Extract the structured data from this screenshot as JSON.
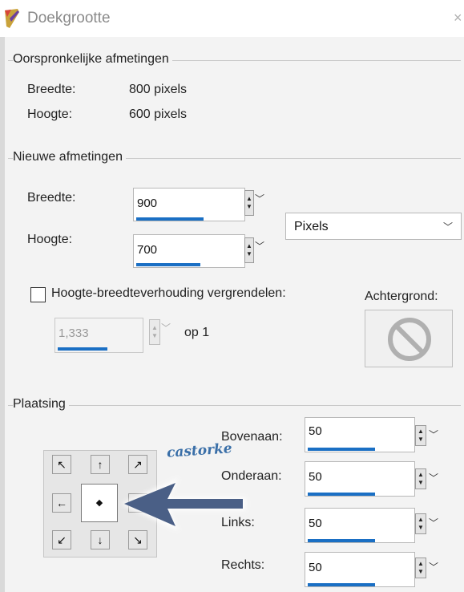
{
  "window": {
    "title": "Doekgrootte",
    "close_icon": "close-icon"
  },
  "original": {
    "section_title": "Oorspronkelijke afmetingen",
    "width_label": "Breedte:",
    "width_value": "800 pixels",
    "height_label": "Hoogte:",
    "height_value": "600 pixels"
  },
  "new_dims": {
    "section_title": "Nieuwe afmetingen",
    "width_label": "Breedte:",
    "width_value": "900",
    "height_label": "Hoogte:",
    "height_value": "700",
    "unit_selected": "Pixels",
    "lock_label": "Hoogte-breedteverhouding vergrendelen:",
    "lock_checked": false,
    "ratio_value": "1,333",
    "ratio_suffix": "op 1",
    "background_label": "Achtergrond:"
  },
  "placement": {
    "section_title": "Plaatsing",
    "top_label": "Bovenaan:",
    "top_value": "50",
    "bottom_label": "Onderaan:",
    "bottom_value": "50",
    "left_label": "Links:",
    "left_value": "50",
    "right_label": "Rechts:",
    "right_value": "50",
    "anchor_selected": "center",
    "glyphs": {
      "nw": "↖",
      "n": "↑",
      "ne": "↗",
      "w": "←",
      "c": "◆",
      "e": "→",
      "sw": "↙",
      "s": "↓",
      "se": "↘"
    }
  },
  "watermark": {
    "text": "castorke"
  },
  "colors": {
    "accent": "#1a6fc4",
    "arrow": "#4a5f86"
  }
}
